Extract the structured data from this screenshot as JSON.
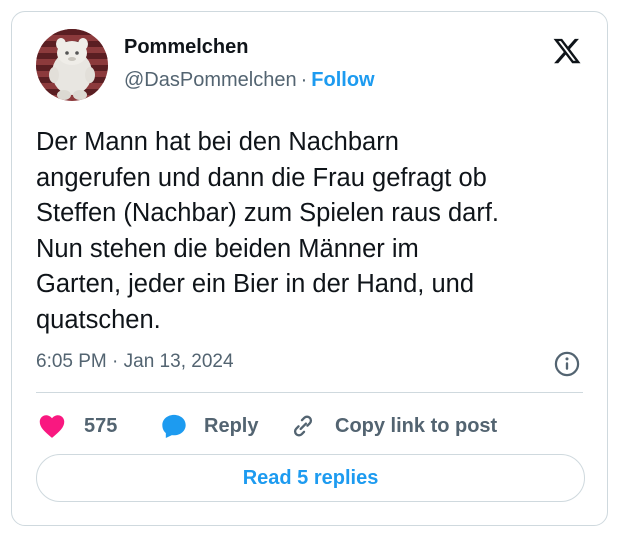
{
  "author": {
    "display_name": "Pommelchen",
    "handle": "@DasPommelchen",
    "separator": "·",
    "follow_label": "Follow"
  },
  "tweet": {
    "text": "Der Mann hat bei den Nachbarn\nangerufen und dann die Frau gefragt ob\nSteffen (Nachbar) zum Spielen raus darf.\nNun stehen die beiden Männer im\nGarten, jeder ein Bier in der Hand, und\nquatschen.",
    "timestamp": "6:05 PM · Jan 13, 2024"
  },
  "actions": {
    "like_count": "575",
    "reply_label": "Reply",
    "copy_link_label": "Copy link to post"
  },
  "footer": {
    "read_replies_label": "Read 5 replies"
  },
  "icons": {
    "logo": "x-logo-icon",
    "info": "info-icon",
    "like": "heart-icon",
    "reply": "speech-bubble-icon",
    "copy": "link-icon"
  },
  "colors": {
    "accent": "#1d9bf0",
    "like": "#f91880",
    "secondary_text": "#536471",
    "border": "#cfd9de"
  }
}
